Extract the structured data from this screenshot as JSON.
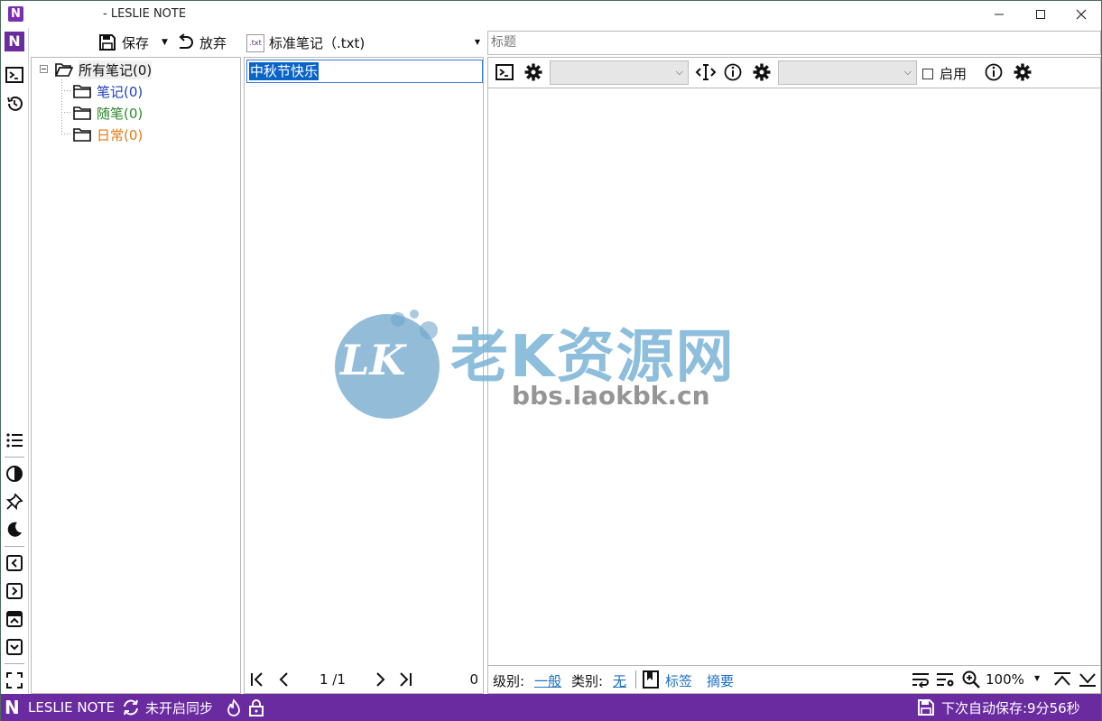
{
  "window": {
    "title": "- LESLIE NOTE",
    "logo_letter": "N"
  },
  "toolbar": {
    "save_label": "保存",
    "discard_label": "放弃",
    "note_type_badge": ".txt",
    "note_type_label": "标准笔记（.txt)"
  },
  "tree": {
    "root_label": "所有笔记(0)",
    "children": [
      {
        "label": "笔记(0)",
        "color": "#1f3fb8"
      },
      {
        "label": "随笔(0)",
        "color": "#2a8a2a"
      },
      {
        "label": "日常(0)",
        "color": "#e07a10"
      }
    ]
  },
  "list": {
    "items": [
      "中秋节快乐"
    ],
    "pager_text": "1 /1",
    "count": "0"
  },
  "editor": {
    "title_placeholder": "标题",
    "enable_label": "启用",
    "level_label": "级别:",
    "level_value": "一般",
    "category_label": "类别:",
    "category_value": "无",
    "tags_label": "标签",
    "summary_label": "摘要",
    "zoom": "100%"
  },
  "statusbar": {
    "app_name": "LESLIE NOTE",
    "sync_status": "未开启同步",
    "autosave": "下次自动保存:9分56秒"
  },
  "watermark": {
    "logo_text": "LK",
    "site_name": "老K资源网",
    "url": "bbs.laokbk.cn"
  },
  "colors": {
    "accent": "#6a2aa0",
    "selection": "#0a64c8",
    "link": "#1a6fc4"
  }
}
